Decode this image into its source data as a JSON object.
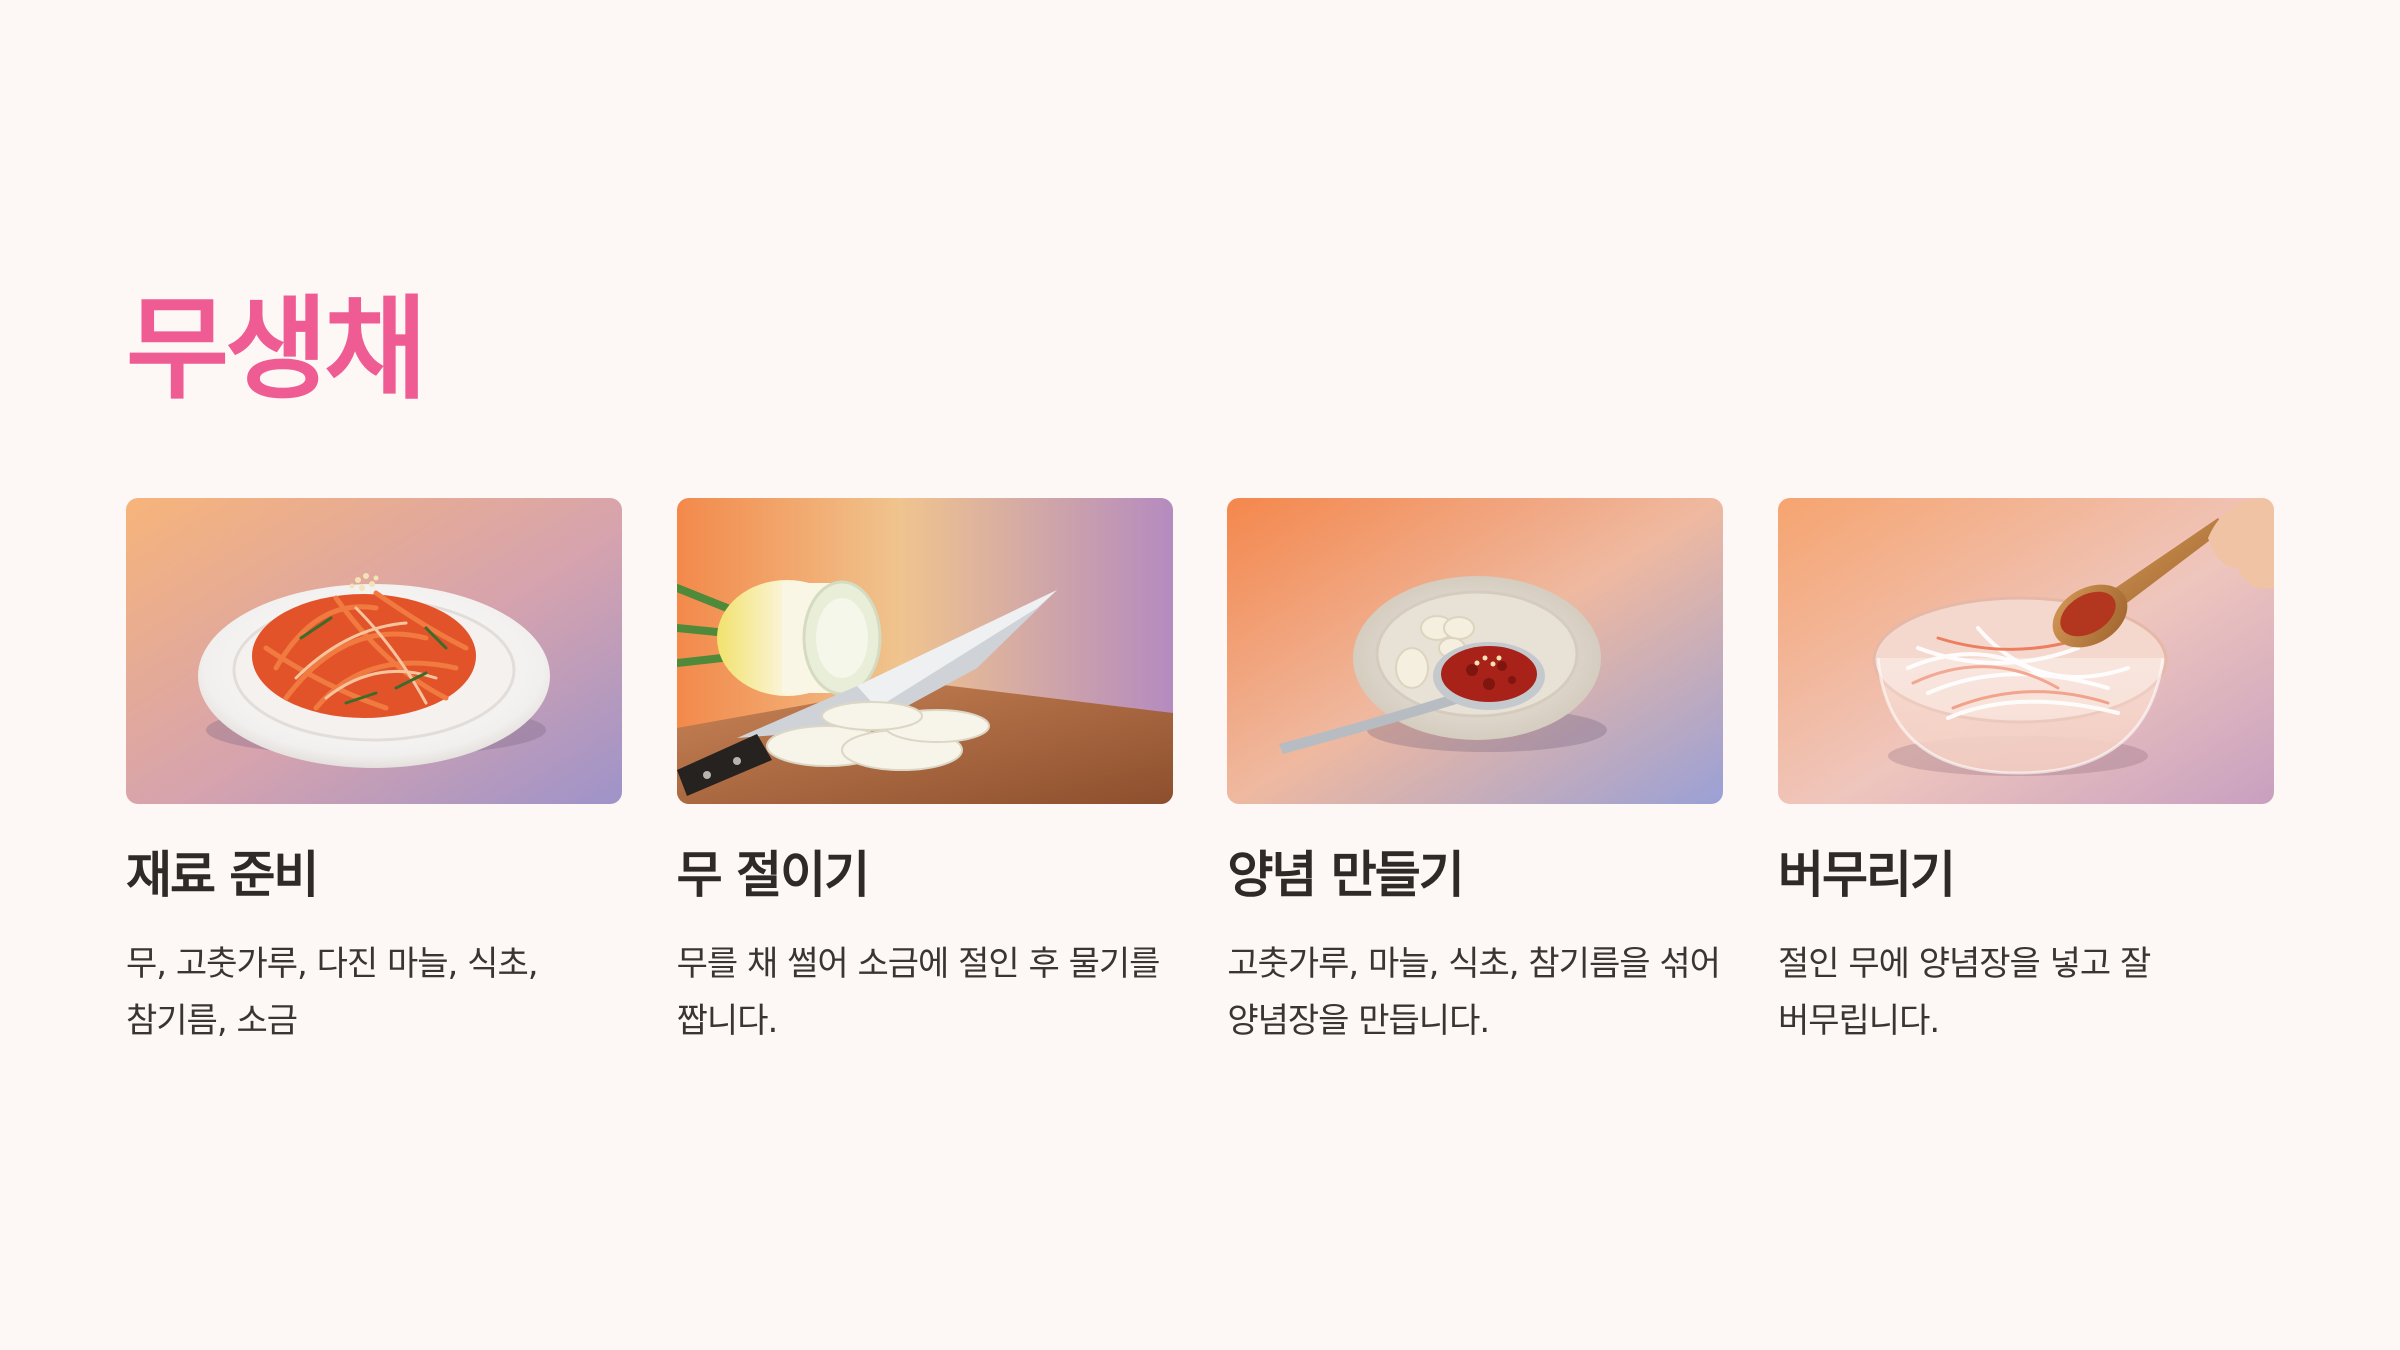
{
  "page": {
    "title": "무생채",
    "accent_color": "#ef5c93",
    "background_color": "#fdf8f5"
  },
  "steps": [
    {
      "title": "재료 준비",
      "description": "무, 고춧가루, 다진 마늘, 식초, 참기름, 소금",
      "image": "radish-salad-plate-photo"
    },
    {
      "title": "무 절이기",
      "description": "무를 채 썰어 소금에 절인 후 물기를 짭니다.",
      "image": "sliced-radish-knife-photo"
    },
    {
      "title": "양념 만들기",
      "description": "고춧가루, 마늘, 식초, 참기름을 섞어 양념장을 만듭니다.",
      "image": "seasoning-bowl-photo"
    },
    {
      "title": "버무리기",
      "description": "절인 무에 양념장을 넣고 잘 버무립니다.",
      "image": "mixing-bowl-spoon-photo"
    }
  ]
}
